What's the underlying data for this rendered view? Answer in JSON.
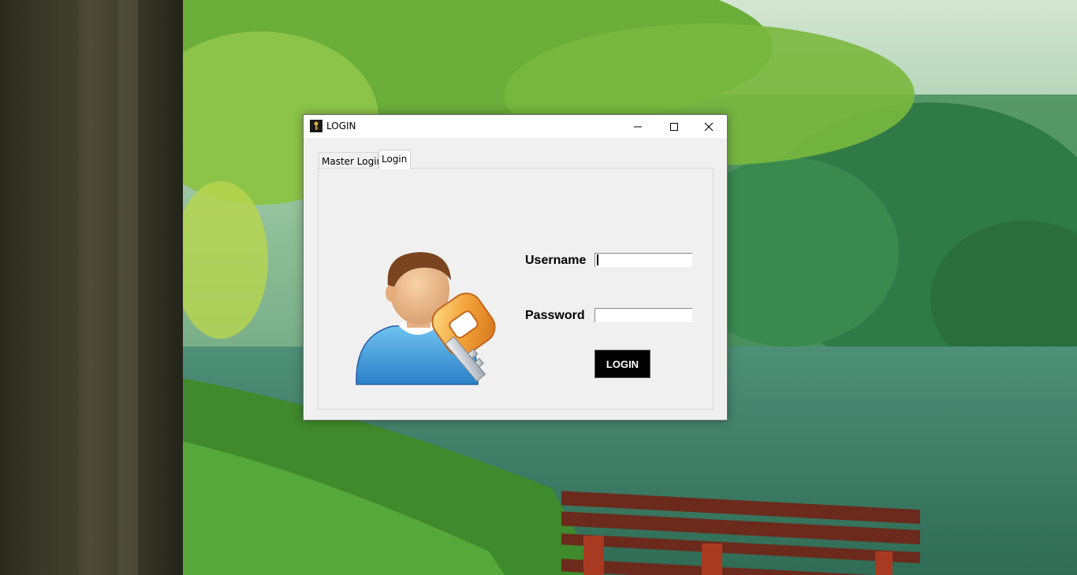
{
  "window": {
    "title": "LOGIN",
    "app_icon": "key-icon",
    "caption_buttons": [
      "minimize-icon",
      "maximize-icon",
      "close-icon"
    ]
  },
  "tabs": [
    {
      "label": "Master Login",
      "selected": false
    },
    {
      "label": "Login",
      "selected": true
    }
  ],
  "form": {
    "username_label": "Username",
    "username_value": "",
    "password_label": "Password",
    "password_value": "",
    "login_button": "LOGIN"
  },
  "illustration": "user-key-icon",
  "colors": {
    "button_bg": "#000000",
    "button_text": "#ffffff",
    "panel_bg": "#f0f0f0",
    "titlebar_bg": "#ffffff"
  }
}
